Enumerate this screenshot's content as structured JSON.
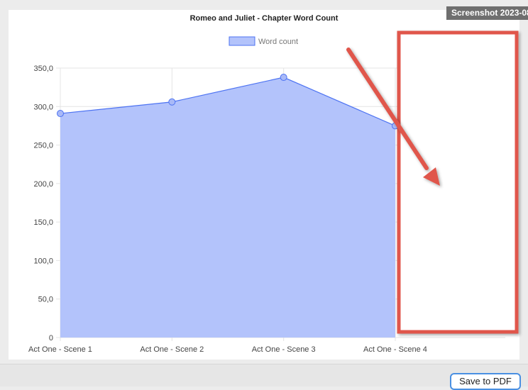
{
  "chart_data": {
    "type": "area",
    "title": "Romeo and Juliet - Chapter Word Count",
    "categories": [
      "Act One - Scene 1",
      "Act One - Scene 2",
      "Act One - Scene 3",
      "Act One - Scene 4"
    ],
    "series": [
      {
        "name": "Word count",
        "values": [
          291,
          306,
          338,
          275
        ]
      }
    ],
    "ylim": [
      0,
      350
    ],
    "yticks": [
      "0",
      "50,0",
      "100,0",
      "150,0",
      "200,0",
      "250,0",
      "300,0",
      "350,0"
    ],
    "grid": true,
    "legend_position": "top-center",
    "colors": {
      "fill": "#b3c3fb",
      "line": "#4d73f2",
      "point": "#a9b9f7"
    }
  },
  "annotation": {
    "rectangle_color": "#e0574b",
    "arrow_color": "#e0574b"
  },
  "overlay": {
    "screenshot_label": "Screenshot 2023-08"
  },
  "toolbar": {
    "save_label": "Save to PDF"
  }
}
